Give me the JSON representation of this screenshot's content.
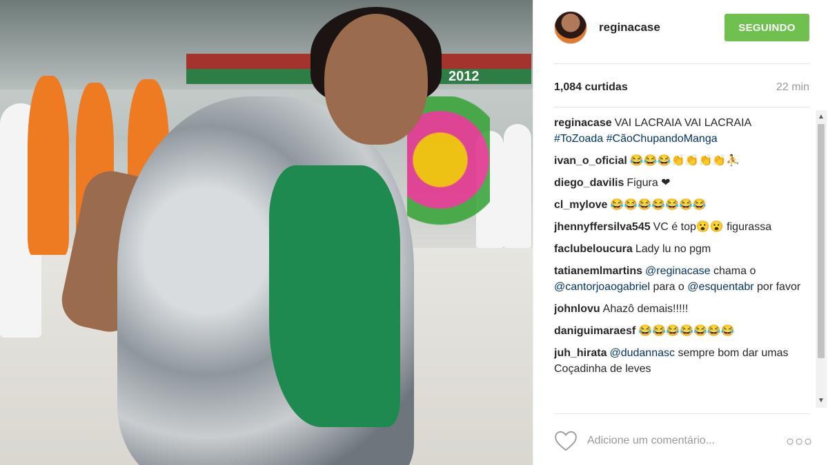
{
  "post": {
    "username": "reginacase",
    "follow_label": "SEGUINDO",
    "likes": "1,084 curtidas",
    "time": "22 min"
  },
  "caption": {
    "user": "reginacase",
    "text": "VAI LACRAIA VAI LACRAIA",
    "hashtags": "#ToZoada #CãoChupandoManga"
  },
  "comments": [
    {
      "user": "ivan_o_oficial",
      "text": "😂😂😂👏👏👏👏⛹"
    },
    {
      "user": "diego_davilis",
      "text": "Figura ❤"
    },
    {
      "user": "cl_mylove",
      "text": "😂😂😂😂😂😂😂"
    },
    {
      "user": "jhennyffersilva545",
      "text": "VC é top😮😮 figurassa"
    },
    {
      "user": "faclubeloucura",
      "text": "Lady lu no pgm"
    },
    {
      "user": "tatianemlmartins",
      "mention1": "@reginacase",
      "text1": " chama o ",
      "mention2": "@cantorjoaogabriel",
      "text2": " para o ",
      "mention3": "@esquentabr",
      "text3": " por favor"
    },
    {
      "user": "johnlovu",
      "text": "Ahazô demais!!!!!"
    },
    {
      "user": "daniguimaraesf",
      "text": "😂😂😂😂😂😂😂"
    },
    {
      "user": "juh_hirata",
      "mention1": "@dudannasc",
      "text1": " sempre bom dar umas Coçadinha de leves"
    }
  ],
  "input": {
    "placeholder": "Adicione um comentário..."
  },
  "icons": {
    "like": "heart-icon",
    "more": "more-options-icon"
  },
  "photo": {
    "banner_text": "2012"
  },
  "colors": {
    "follow_button": "#70c050",
    "mention": "#003569"
  }
}
